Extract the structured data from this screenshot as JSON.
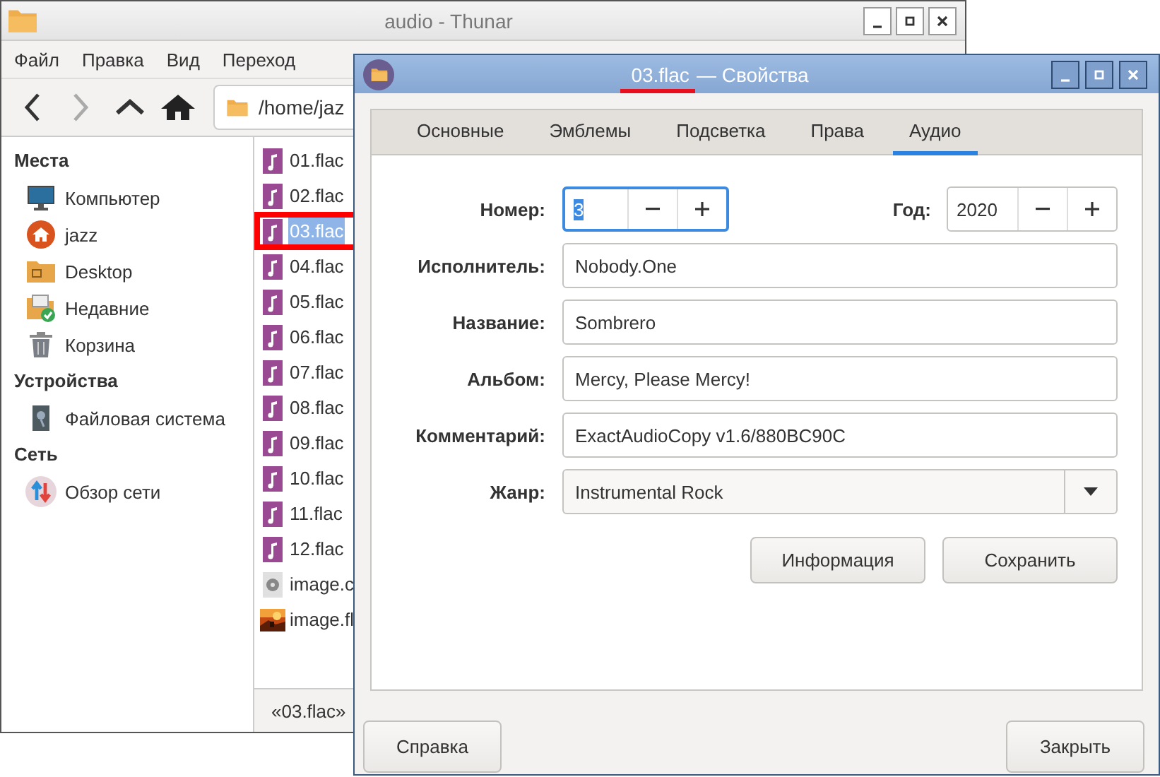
{
  "thunar": {
    "title": "audio - Thunar",
    "menu": [
      "Файл",
      "Правка",
      "Вид",
      "Переход"
    ],
    "location": "/home/jaz",
    "sidebar": [
      {
        "heading": "Места",
        "items": [
          {
            "label": "Компьютер",
            "kind": "computer"
          },
          {
            "label": "jazz",
            "kind": "home"
          },
          {
            "label": "Desktop",
            "kind": "desktop"
          },
          {
            "label": "Недавние",
            "kind": "recent"
          },
          {
            "label": "Корзина",
            "kind": "trash"
          }
        ]
      },
      {
        "heading": "Устройства",
        "items": [
          {
            "label": "Файловая система",
            "kind": "drive"
          }
        ]
      },
      {
        "heading": "Сеть",
        "items": [
          {
            "label": "Обзор сети",
            "kind": "network"
          }
        ]
      }
    ],
    "files": [
      {
        "name": "01.flac",
        "kind": "audio",
        "selected": false,
        "marked": false
      },
      {
        "name": "02.flac",
        "kind": "audio",
        "selected": false,
        "marked": false
      },
      {
        "name": "03.flac",
        "kind": "audio",
        "selected": true,
        "marked": true
      },
      {
        "name": "04.flac",
        "kind": "audio",
        "selected": false,
        "marked": false
      },
      {
        "name": "05.flac",
        "kind": "audio",
        "selected": false,
        "marked": false
      },
      {
        "name": "06.flac",
        "kind": "audio",
        "selected": false,
        "marked": false
      },
      {
        "name": "07.flac",
        "kind": "audio",
        "selected": false,
        "marked": false
      },
      {
        "name": "08.flac",
        "kind": "audio",
        "selected": false,
        "marked": false
      },
      {
        "name": "09.flac",
        "kind": "audio",
        "selected": false,
        "marked": false
      },
      {
        "name": "10.flac",
        "kind": "audio",
        "selected": false,
        "marked": false
      },
      {
        "name": "11.flac",
        "kind": "audio",
        "selected": false,
        "marked": false
      },
      {
        "name": "12.flac",
        "kind": "audio",
        "selected": false,
        "marked": false
      },
      {
        "name": "image.c",
        "kind": "disc",
        "selected": false,
        "marked": false
      },
      {
        "name": "image.fl",
        "kind": "picture",
        "selected": false,
        "marked": false
      }
    ],
    "status": "«03.flac»"
  },
  "dialog": {
    "title_file": "03.flac",
    "title_rest": "— Свойства",
    "title_file_marked": true,
    "tabs": [
      {
        "label": "Основные",
        "selected": false
      },
      {
        "label": "Эмблемы",
        "selected": false
      },
      {
        "label": "Подсветка",
        "selected": false
      },
      {
        "label": "Права",
        "selected": false
      },
      {
        "label": "Аудио",
        "selected": true
      }
    ],
    "number": {
      "label": "Номер:",
      "value": "3",
      "text_selected": true,
      "focused": true
    },
    "year": {
      "label": "Год:",
      "value": "2020"
    },
    "fields": [
      {
        "label": "Исполнитель:",
        "value": "Nobody.One",
        "kind": "text"
      },
      {
        "label": "Название:",
        "value": "Sombrero",
        "kind": "text"
      },
      {
        "label": "Альбом:",
        "value": "Mercy, Please Mercy!",
        "kind": "text"
      },
      {
        "label": "Комментарий:",
        "value": "ExactAudioCopy v1.6/880BC90C",
        "kind": "text"
      },
      {
        "label": "Жанр:",
        "value": "Instrumental Rock",
        "kind": "dropdown"
      }
    ],
    "actions": [
      "Информация",
      "Сохранить"
    ],
    "bottom_buttons": [
      "Справка",
      "Закрыть"
    ]
  }
}
